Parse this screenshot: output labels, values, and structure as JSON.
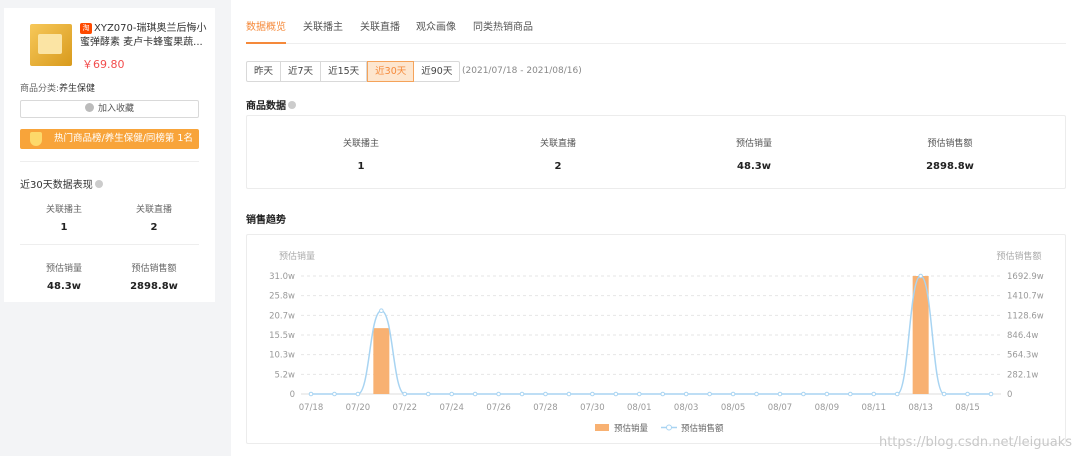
{
  "product": {
    "title": "XYZ070-瑞琪奥兰后悔小蜜弹酵素 麦卢卡蜂蜜果蔬...",
    "badge": "淘",
    "price": "￥69.80",
    "category_label": "商品分类:",
    "category_value": "养生保健",
    "favorite_label": "加入收藏",
    "rank_text": "热门商品榜/养生保健/同榜第 1名"
  },
  "recent": {
    "title": "近30天数据表现",
    "stats": [
      {
        "label": "关联播主",
        "value": "1"
      },
      {
        "label": "关联直播",
        "value": "2"
      },
      {
        "label": "预估销量",
        "value": "48.3w"
      },
      {
        "label": "预估销售额",
        "value": "2898.8w"
      }
    ]
  },
  "tabs": [
    "数据概览",
    "关联播主",
    "关联直播",
    "观众画像",
    "同类热销商品"
  ],
  "ranges": [
    "昨天",
    "近7天",
    "近15天",
    "近30天",
    "近90天"
  ],
  "active_range": "近30天",
  "date_range": "(2021/07/18 - 2021/08/16)",
  "goods_section": {
    "title": "商品数据",
    "metrics": [
      {
        "label": "关联播主",
        "value": "1"
      },
      {
        "label": "关联直播",
        "value": "2"
      },
      {
        "label": "预估销量",
        "value": "48.3w"
      },
      {
        "label": "预估销售额",
        "value": "2898.8w"
      }
    ]
  },
  "trend_title": "销售趋势",
  "watermark": "https://blog.csdn.net/leiguaks",
  "chart_data": {
    "type": "bar",
    "x": [
      "07/18",
      "07/19",
      "07/20",
      "07/21",
      "07/22",
      "07/23",
      "07/24",
      "07/25",
      "07/26",
      "07/27",
      "07/28",
      "07/29",
      "07/30",
      "07/31",
      "08/01",
      "08/02",
      "08/03",
      "08/04",
      "08/05",
      "08/06",
      "08/07",
      "08/08",
      "08/09",
      "08/10",
      "08/11",
      "08/12",
      "08/13",
      "08/14",
      "08/15",
      "08/16"
    ],
    "x_tick_labels": [
      "07/18",
      "07/20",
      "07/22",
      "07/24",
      "07/26",
      "07/28",
      "07/30",
      "08/01",
      "08/03",
      "08/05",
      "08/07",
      "08/09",
      "08/11",
      "08/13",
      "08/15"
    ],
    "ylabel_left": "预估销量",
    "ylabel_right": "预估销售额",
    "yticks_left": [
      "0",
      "5.2w",
      "10.3w",
      "15.5w",
      "20.7w",
      "25.8w",
      "31.0w"
    ],
    "yticks_right": [
      "0",
      "282.1w",
      "564.3w",
      "846.4w",
      "1128.6w",
      "1410.7w",
      "1692.9w"
    ],
    "ylim_left": [
      0,
      31.0
    ],
    "ylim_right": [
      0,
      1692.9
    ],
    "series": [
      {
        "name": "预估销量",
        "kind": "bar",
        "color": "#f8b172",
        "values": [
          0,
          0,
          0,
          17.3,
          0,
          0,
          0,
          0,
          0,
          0,
          0,
          0,
          0,
          0,
          0,
          0,
          0,
          0,
          0,
          0,
          0,
          0,
          0,
          0,
          0,
          0,
          31.0,
          0,
          0,
          0
        ]
      },
      {
        "name": "预估销售额",
        "kind": "line",
        "color": "#a8d4f2",
        "values": [
          0,
          0,
          0,
          1195,
          0,
          0,
          0,
          0,
          0,
          0,
          0,
          0,
          0,
          0,
          0,
          0,
          0,
          0,
          0,
          0,
          0,
          0,
          0,
          0,
          0,
          0,
          1692.9,
          0,
          0,
          0
        ]
      }
    ],
    "grid": true,
    "legend": "bottom"
  }
}
